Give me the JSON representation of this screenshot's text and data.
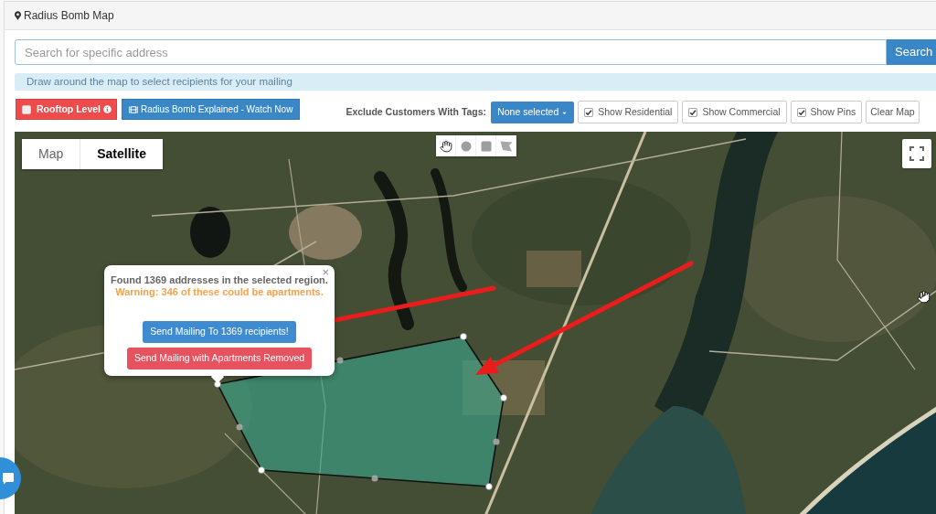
{
  "panel": {
    "title": "Radius Bomb Map"
  },
  "search": {
    "placeholder": "Search for specific address",
    "button": "Search"
  },
  "alert": {
    "text": "Draw around the map to select recipients for your mailing"
  },
  "toolbar": {
    "rooftop": {
      "label": "Rooftop Level",
      "checked": false
    },
    "video_button": "Radius Bomb Explained - Watch Now",
    "exclude_label": "Exclude Customers With Tags:",
    "tags_dropdown": "None selected",
    "toggles": [
      {
        "label": "Show Residential",
        "checked": true
      },
      {
        "label": "Show Commercial",
        "checked": true
      },
      {
        "label": "Show Pins",
        "checked": true
      }
    ],
    "clear_button": "Clear Map"
  },
  "map": {
    "type_tabs": [
      {
        "label": "Map",
        "selected": false
      },
      {
        "label": "Satellite",
        "selected": true
      }
    ],
    "draw_tools": [
      {
        "kind": "hand"
      },
      {
        "kind": "circle"
      },
      {
        "kind": "rectangle"
      },
      {
        "kind": "polygon"
      }
    ],
    "popup": {
      "close": "×",
      "summary": "Found 1369 addresses in the selected region.",
      "warning": "Warning: 346 of these could be apartments.",
      "buttons": [
        {
          "label": "Send Mailing To 1369 recipients!",
          "kind": "primary"
        },
        {
          "label": "Send Mailing with Apartments Removed",
          "kind": "danger"
        }
      ]
    }
  }
}
